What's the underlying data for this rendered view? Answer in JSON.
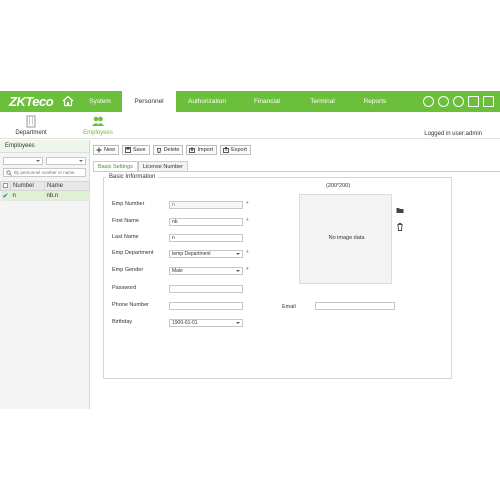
{
  "logo": {
    "text": "ZKTeco"
  },
  "nav": {
    "items": [
      {
        "label": "System"
      },
      {
        "label": "Personnel"
      },
      {
        "label": "Authorization"
      },
      {
        "label": "Financial"
      },
      {
        "label": "Terminal"
      },
      {
        "label": "Reports"
      }
    ],
    "active": "Personnel"
  },
  "modules": {
    "department": "Department",
    "employees": "Employees"
  },
  "user": {
    "logged_in": "Logged in user:admin"
  },
  "left_panel": {
    "title": "Employees",
    "search_placeholder": "By personnel number or name",
    "columns": [
      "Number",
      "Name"
    ],
    "rows": [
      {
        "number": "n",
        "name": "nb.n"
      }
    ]
  },
  "toolbar": {
    "new": "New",
    "save": "Save",
    "delete": "Delete",
    "import": "Import",
    "export": "Export"
  },
  "tabs": {
    "basic": "Basic Settings",
    "license": "License Number"
  },
  "form": {
    "section": "Basic  Information",
    "emp_number_label": "Emp Number",
    "emp_number_value": "n",
    "first_name_label": "First Name",
    "first_name_value": "nb",
    "last_name_label": "Last Name",
    "last_name_value": "n",
    "dept_label": "Emp Department",
    "dept_value": "temp Department",
    "gender_label": "Emp Gender",
    "gender_value": "Male",
    "password_label": "Password",
    "password_value": "",
    "phone_label": "Phone Number",
    "phone_value": "",
    "email_label": "Email",
    "email_value": "",
    "birthday_label": "Birthday",
    "birthday_value": "1900-01-01"
  },
  "photo": {
    "size": "(200*200)",
    "empty": "No image data"
  },
  "colors": {
    "brand_green": "#6cbf3a",
    "required_red": "#e23a3a"
  }
}
